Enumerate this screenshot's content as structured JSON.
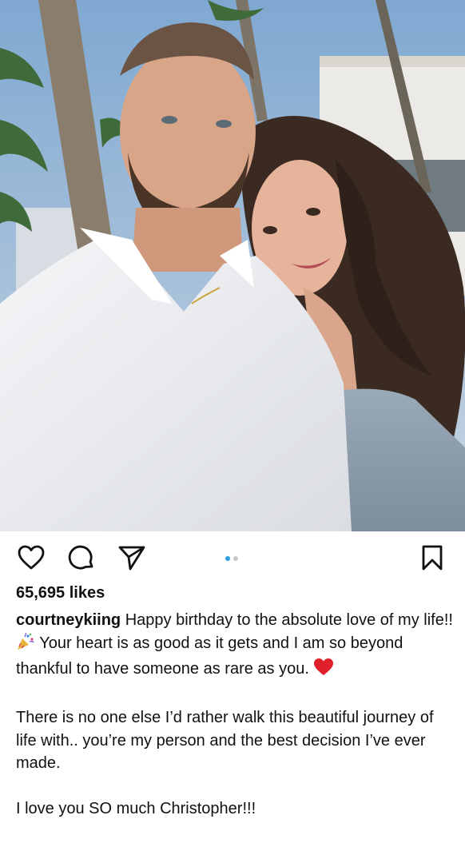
{
  "post": {
    "photo": {
      "alt_icon": "couple-selfie-photo"
    },
    "actions": {
      "like_icon": "heart-outline-icon",
      "comment_icon": "comment-bubble-icon",
      "share_icon": "paper-plane-icon",
      "save_icon": "bookmark-icon"
    },
    "carousel": {
      "count": 2,
      "active_index": 0
    },
    "likes_text": "65,695 likes",
    "caption": {
      "username": "courtneykiing",
      "line1": "Happy birthday to the absolute love of my life!!",
      "emoji1": "party-popper-emoji",
      "line2": "Your heart is as good as it gets and I am so beyond thankful to have someone as rare as you.",
      "emoji2": "red-heart-emoji",
      "paragraph2": "There is no one else I’d rather walk this beautiful journey of life with.. you’re my person and the best decision I’ve ever made.",
      "paragraph3": "I love you SO much Christopher!!!"
    },
    "colors": {
      "carousel_active": "#2d9cdb",
      "heart_emoji": "#e0202a",
      "text": "#111111"
    }
  }
}
